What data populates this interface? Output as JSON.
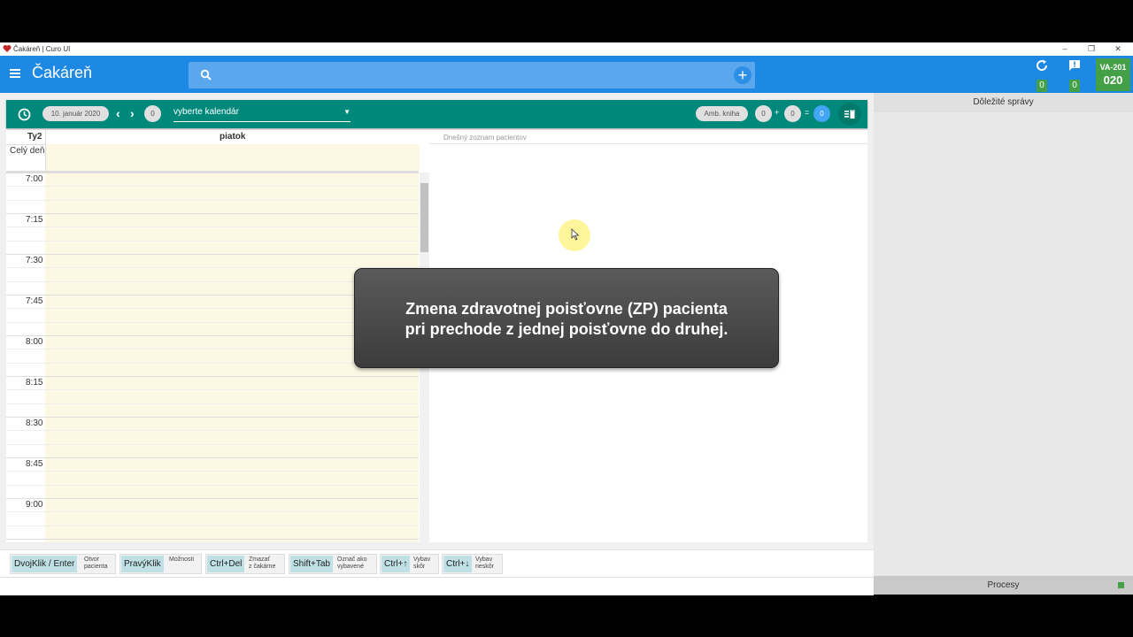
{
  "window": {
    "title": "Čakáreň | Curo UI",
    "minimize": "–",
    "restore": "❐",
    "close": "✕"
  },
  "header": {
    "title": "Čakáreň",
    "add_label": "+",
    "sync_count": "0",
    "messages_count": "0",
    "room_code": "VA-201",
    "room_number": "020"
  },
  "toolbar": {
    "date": "10. január 2020",
    "prev": "‹",
    "next": "›",
    "count": "0",
    "calendar_select": "vyberte kalendár",
    "amb_book": "Amb. kniha",
    "count_a": "0",
    "plus": "+",
    "count_b": "0",
    "equals": "=",
    "count_total": "0"
  },
  "calendar": {
    "week": "Ty2",
    "day": "piatok",
    "all_day": "Celý deň",
    "times": [
      "7:00",
      "7:15",
      "7:30",
      "7:45",
      "8:00",
      "8:15",
      "8:30",
      "8:45",
      "9:00"
    ]
  },
  "patients": {
    "label": "Dnešný zoznam pacientov"
  },
  "right_panel": {
    "title": "Dôležité správy",
    "footer": "Procesy"
  },
  "shortcuts": [
    {
      "key": "DvojKlik / Enter",
      "line1": "Otvor",
      "line2": "pacienta"
    },
    {
      "key": "PravýKlik",
      "line1": "Možnosti",
      "line2": ""
    },
    {
      "key": "Ctrl+Del",
      "line1": "Zmazať",
      "line2": "z čakárne"
    },
    {
      "key": "Shift+Tab",
      "line1": "Označ ako",
      "line2": "vybavené"
    },
    {
      "key": "Ctrl+↑",
      "line1": "Vybav",
      "line2": "skôr"
    },
    {
      "key": "Ctrl+↓",
      "line1": "Vybav",
      "line2": "neskôr"
    }
  ],
  "caption": {
    "line1": "Zmena zdravotnej poisťovne (ZP) pacienta",
    "line2": "pri prechode z jednej poisťovne do druhej."
  },
  "colors": {
    "header": "#1e88e5",
    "toolbar": "#00897b",
    "badge": "#43a047",
    "day_bg": "#fdf8e4"
  }
}
